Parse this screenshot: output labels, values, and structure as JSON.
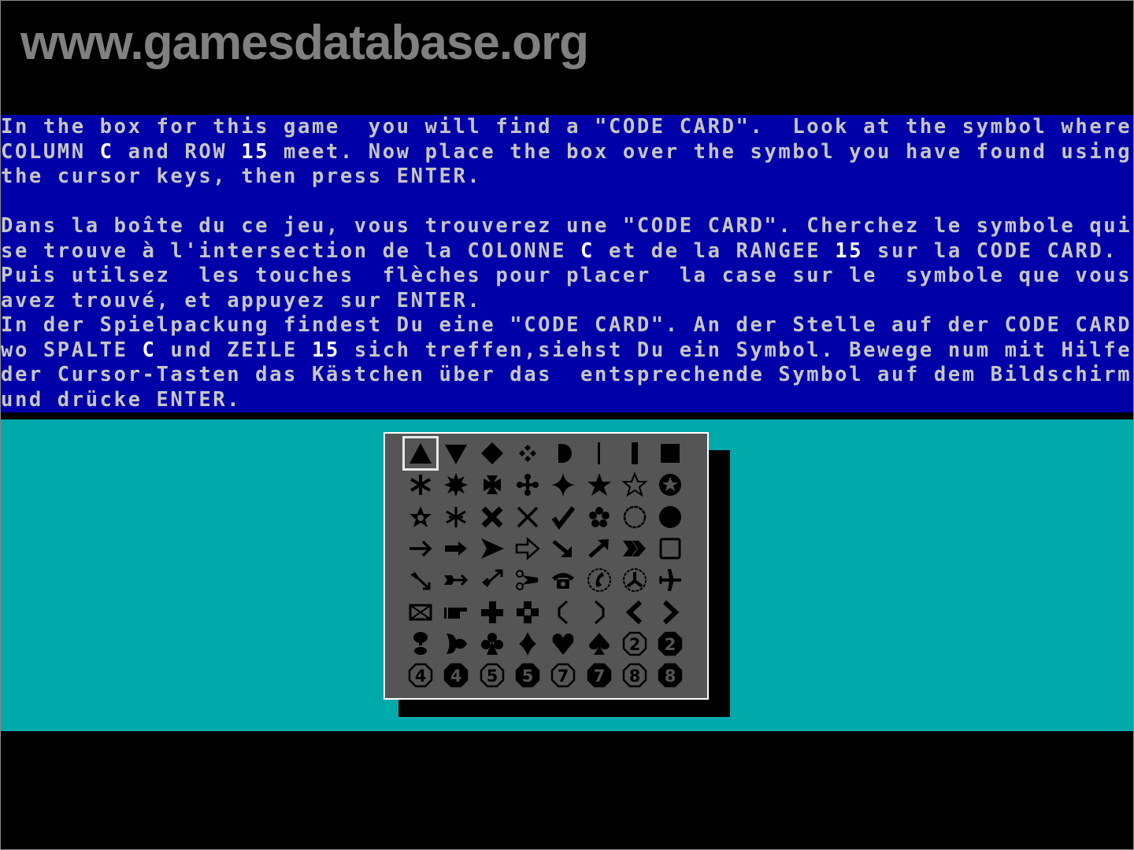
{
  "watermark": "www.gamesdatabase.org",
  "colors": {
    "text_panel_bg": "#0000a8",
    "text": "#c6c6c6",
    "highlight": "#ffffff",
    "playfield_bg": "#00aaaa",
    "grid_bg": "#555555",
    "symbol": "#000000"
  },
  "instructions": {
    "english": [
      [
        "In the box for this game  you will find a \"CODE CARD\".  Look at the symbol where"
      ],
      [
        "COLUMN ",
        {
          "hl": "C"
        },
        " and ROW ",
        {
          "hl": "15"
        },
        " meet. Now place the box over the symbol you have found using"
      ],
      [
        "the cursor keys, then press ENTER."
      ]
    ],
    "french": [
      [
        "Dans la boîte du ce jeu, vous trouverez une \"CODE CARD\". Cherchez le symbole qui"
      ],
      [
        "se trouve à l'intersection de la COLONNE ",
        {
          "hl": "C"
        },
        " et de la RANGEE ",
        {
          "hl": "15"
        },
        " sur la CODE CARD."
      ],
      [
        "Puis utilsez  les touches  flèches pour placer  la case sur le  symbole que vous"
      ],
      [
        "avez trouvé, et appuyez sur ENTER."
      ]
    ],
    "german": [
      [
        "In der Spielpackung findest Du eine \"CODE CARD\". An der Stelle auf der CODE CARD"
      ],
      [
        "wo SPALTE ",
        {
          "hl": "C"
        },
        " und ZEILE ",
        {
          "hl": "15"
        },
        " sich treffen,siehst Du ein Symbol. Bewege num mit Hilfe"
      ],
      [
        "der Cursor-Tasten das Kästchen über das  entsprechende Symbol auf dem Bildschirm"
      ],
      [
        "und drücke ENTER."
      ]
    ]
  },
  "code_prompt": {
    "column": "C",
    "row": "15"
  },
  "symbol_grid": {
    "rows": 8,
    "cols": 8,
    "selected": {
      "row": 0,
      "col": 0
    },
    "symbols": [
      [
        "triangle-up",
        "triangle-down",
        "diamond",
        "four-diamonds",
        "half-circle",
        "thin-bar",
        "thick-bar",
        "square"
      ],
      [
        "asterisk",
        "eight-point-star",
        "maltese-cross",
        "four-petal-cross",
        "four-point-star",
        "star",
        "star-outline",
        "circled-star"
      ],
      [
        "open-star",
        "snowflake",
        "x-heavy",
        "x-thin",
        "checkmark",
        "flower",
        "circle-outline",
        "circle-filled"
      ],
      [
        "arrow-right",
        "arrow-right-heavy",
        "arrowhead-right",
        "arrow-right-outline",
        "arrow-down-right",
        "arrow-up-right",
        "double-arrowhead-right",
        "square-outline"
      ],
      [
        "arrow-down-right-feather",
        "arrow-right-feather",
        "arrow-up-right-feather",
        "scissors",
        "telephone",
        "circled-phone",
        "circled-y",
        "airplane"
      ],
      [
        "envelope",
        "pointing-hand",
        "plus-heavy",
        "plus-outline",
        "paren-left",
        "paren-right",
        "chevron-left",
        "chevron-right"
      ],
      [
        "florette-bottom",
        "heart-rotated",
        "club",
        "diamond-suit",
        "heart",
        "spade",
        "circled-2",
        "circled-2-filled"
      ],
      [
        "circled-4",
        "circled-4-filled",
        "circled-5",
        "circled-5-filled",
        "circled-7",
        "circled-7-filled",
        "circled-8",
        "circled-8-filled"
      ]
    ]
  }
}
